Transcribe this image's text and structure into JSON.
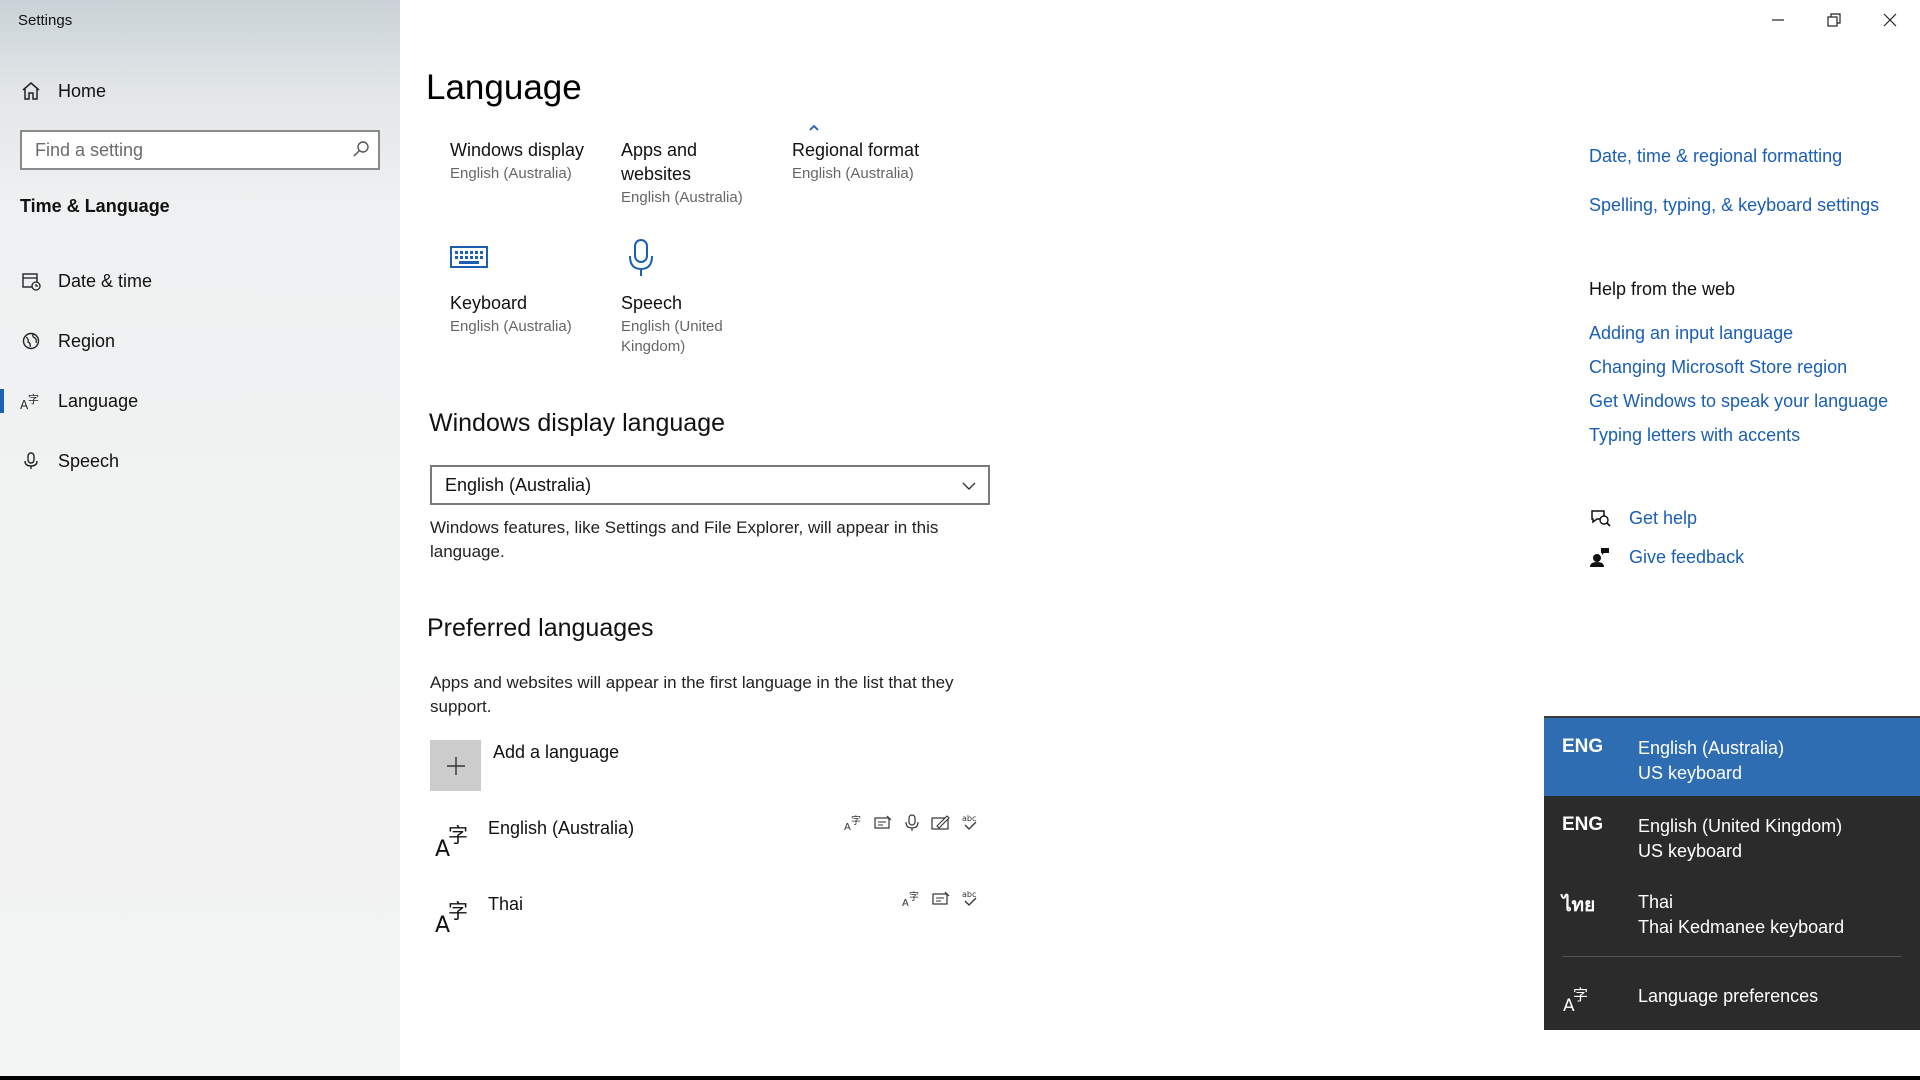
{
  "window": {
    "title": "Settings",
    "controls": {
      "minimize": "minimize",
      "restore": "restore",
      "close": "close"
    }
  },
  "sidebar": {
    "home_label": "Home",
    "search_placeholder": "Find a setting",
    "section_title": "Time & Language",
    "items": [
      {
        "label": "Date & time",
        "icon": "calendar-clock-icon"
      },
      {
        "label": "Region",
        "icon": "globe-icon"
      },
      {
        "label": "Language",
        "icon": "language-icon",
        "active": true
      },
      {
        "label": "Speech",
        "icon": "microphone-icon"
      }
    ]
  },
  "main": {
    "title": "Language",
    "tiles": [
      {
        "title": "Windows display",
        "subtitle": "English (Australia)"
      },
      {
        "title": "Apps and websites",
        "subtitle": "English (Australia)"
      },
      {
        "title": "Regional format",
        "subtitle": "English (Australia)"
      },
      {
        "title": "Keyboard",
        "subtitle": "English (Australia)"
      },
      {
        "title": "Speech",
        "subtitle": "English (United Kingdom)"
      }
    ],
    "display_language": {
      "heading": "Windows display language",
      "selected": "English (Australia)",
      "description": "Windows features, like Settings and File Explorer, will appear in this language."
    },
    "preferred": {
      "heading": "Preferred languages",
      "description": "Apps and websites will appear in the first language in the list that they support.",
      "add_label": "Add a language",
      "languages": [
        {
          "name": "English (Australia)",
          "features": [
            "display-language-icon",
            "text-to-speech-icon",
            "speech-recognition-icon",
            "handwriting-icon",
            "spell-check-icon"
          ]
        },
        {
          "name": "Thai",
          "features": [
            "display-language-icon",
            "text-to-speech-icon",
            "spell-check-icon"
          ]
        }
      ]
    }
  },
  "related": {
    "links": [
      "Date, time & regional formatting",
      "Spelling, typing, & keyboard settings"
    ],
    "help_heading": "Help from the web",
    "help_links": [
      "Adding an input language",
      "Changing Microsoft Store region",
      "Get Windows to speak your language",
      "Typing letters with accents"
    ],
    "get_help": "Get help",
    "give_feedback": "Give feedback"
  },
  "input_flyout": {
    "items": [
      {
        "abbr": "ENG",
        "language": "English (Australia)",
        "keyboard": "US keyboard",
        "selected": true
      },
      {
        "abbr": "ENG",
        "language": "English (United Kingdom)",
        "keyboard": "US keyboard",
        "selected": false
      },
      {
        "abbr": "ไทย",
        "language": "Thai",
        "keyboard": "Thai Kedmanee keyboard",
        "selected": false
      }
    ],
    "preferences_label": "Language preferences"
  },
  "colors": {
    "accent": "#1f62b4",
    "link": "#1a5fb4",
    "flyout_bg": "#2b2b2b",
    "flyout_selected": "#2e6db1"
  }
}
